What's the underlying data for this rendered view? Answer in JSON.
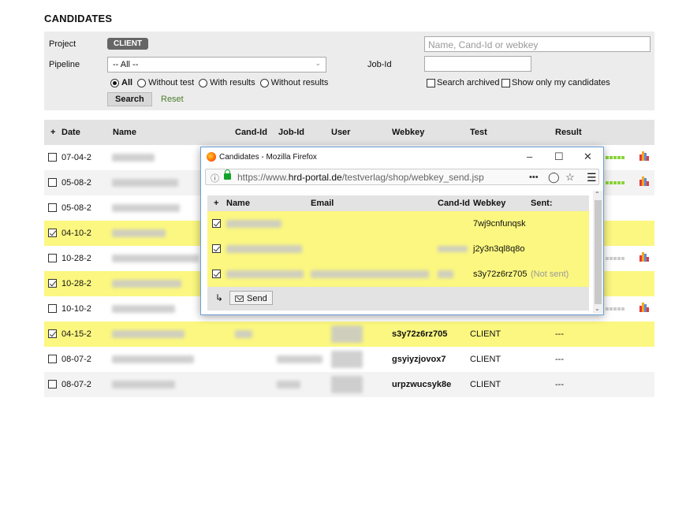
{
  "page": {
    "title": "CANDIDATES"
  },
  "filters": {
    "project_label": "Project",
    "project_value": "CLIENT",
    "pipeline_label": "Pipeline",
    "pipeline_value": "-- All --",
    "search_placeholder": "Name, Cand-Id or webkey",
    "jobid_label": "Job-Id",
    "jobid_value": "",
    "radios": [
      "All",
      "Without test",
      "With results",
      "Without results"
    ],
    "radio_selected": "All",
    "search_archived": "Search archived",
    "show_only_mine": "Show only my candidates",
    "search_button": "Search",
    "reset_link": "Reset"
  },
  "table": {
    "headers": {
      "sort": "+",
      "date": "Date",
      "name": "Name",
      "cand_id": "Cand-Id",
      "job_id": "Job-Id",
      "user": "User",
      "webkey": "Webkey",
      "test": "Test",
      "result": "Result"
    },
    "rows": [
      {
        "checked": false,
        "date": "07-04-2",
        "webkey": "",
        "test": "",
        "result": ""
      },
      {
        "checked": false,
        "date": "05-08-2",
        "webkey": "",
        "test": "",
        "result": ""
      },
      {
        "checked": false,
        "date": "05-08-2",
        "webkey": "",
        "test": "",
        "result": ""
      },
      {
        "checked": true,
        "date": "04-10-2",
        "webkey": "",
        "test": "",
        "result": ""
      },
      {
        "checked": false,
        "date": "10-28-2",
        "webkey": "",
        "test": "",
        "result": ""
      },
      {
        "checked": true,
        "date": "10-28-2",
        "webkey": "",
        "test": "",
        "result": ""
      },
      {
        "checked": false,
        "date": "10-10-2",
        "webkey": "",
        "test": "",
        "result": ""
      },
      {
        "checked": true,
        "date": "04-15-2",
        "webkey": "s3y72z6rz705",
        "test": "CLIENT",
        "result": "---"
      },
      {
        "checked": false,
        "date": "08-07-2",
        "webkey": "gsyiyzjovox7",
        "test": "CLIENT",
        "result": "---"
      },
      {
        "checked": false,
        "date": "08-07-2",
        "webkey": "urpzwucsyk8e",
        "test": "CLIENT",
        "result": "---"
      }
    ]
  },
  "popup": {
    "window_title": "Candidates - Mozilla Firefox",
    "url_prefix": "https://www.",
    "url_domain": "hrd-portal.de",
    "url_path": "/testverlag/shop/webkey_send.jsp",
    "more_actions": "•••",
    "headers": {
      "sort": "+",
      "name": "Name",
      "email": "Email",
      "cand_id": "Cand-Id",
      "webkey": "Webkey",
      "sent": "Sent:"
    },
    "rows": [
      {
        "checked": true,
        "webkey": "7wj9cnfunqsk",
        "sent": ""
      },
      {
        "checked": true,
        "webkey": "j2y3n3ql8q8o",
        "sent": ""
      },
      {
        "checked": true,
        "webkey": "s3y72z6rz705",
        "sent": "(Not sent)"
      }
    ],
    "send_button": "Send"
  },
  "colors": {
    "selected_row": "#fbf780",
    "header_bg": "#e3e3e3",
    "link_green": "#4b7d2a",
    "badge_bg": "#666666"
  }
}
